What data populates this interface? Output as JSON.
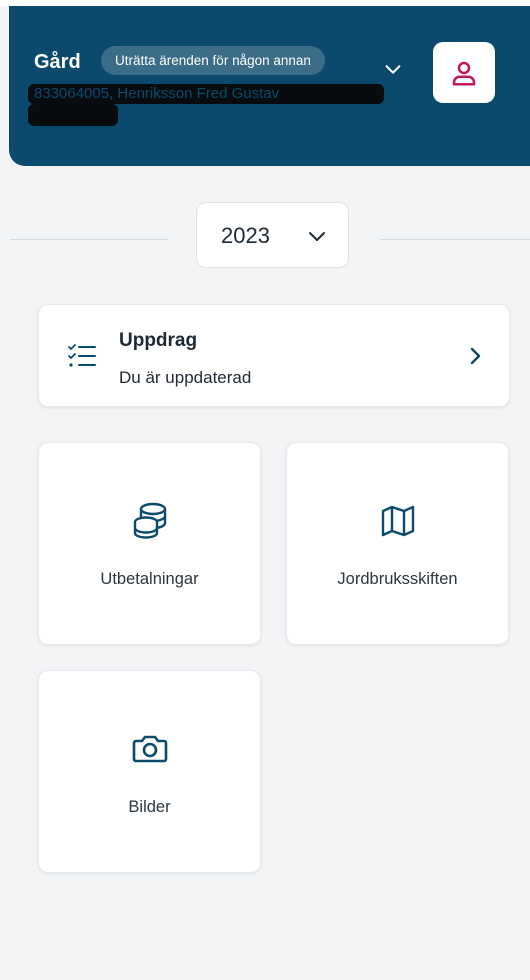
{
  "header": {
    "farm_label": "Gård",
    "act_for_other_label": "Uträtta ärenden för någon annan",
    "identity_text": "833064005, Henriksson Fred Gustav"
  },
  "year_selector": {
    "selected_year": "2023"
  },
  "assignments_card": {
    "title": "Uppdrag",
    "status": "Du är uppdaterad"
  },
  "tiles": [
    {
      "label": "Utbetalningar",
      "icon": "coins-stack-icon"
    },
    {
      "label": "Jordbruksskiften",
      "icon": "map-icon"
    },
    {
      "label": "Bilder",
      "icon": "camera-icon"
    }
  ],
  "colors": {
    "header_bg": "#0b4a6c",
    "accent": "#0b4a6c",
    "user_icon": "#c2185b",
    "page_bg": "#f2f4f6"
  }
}
